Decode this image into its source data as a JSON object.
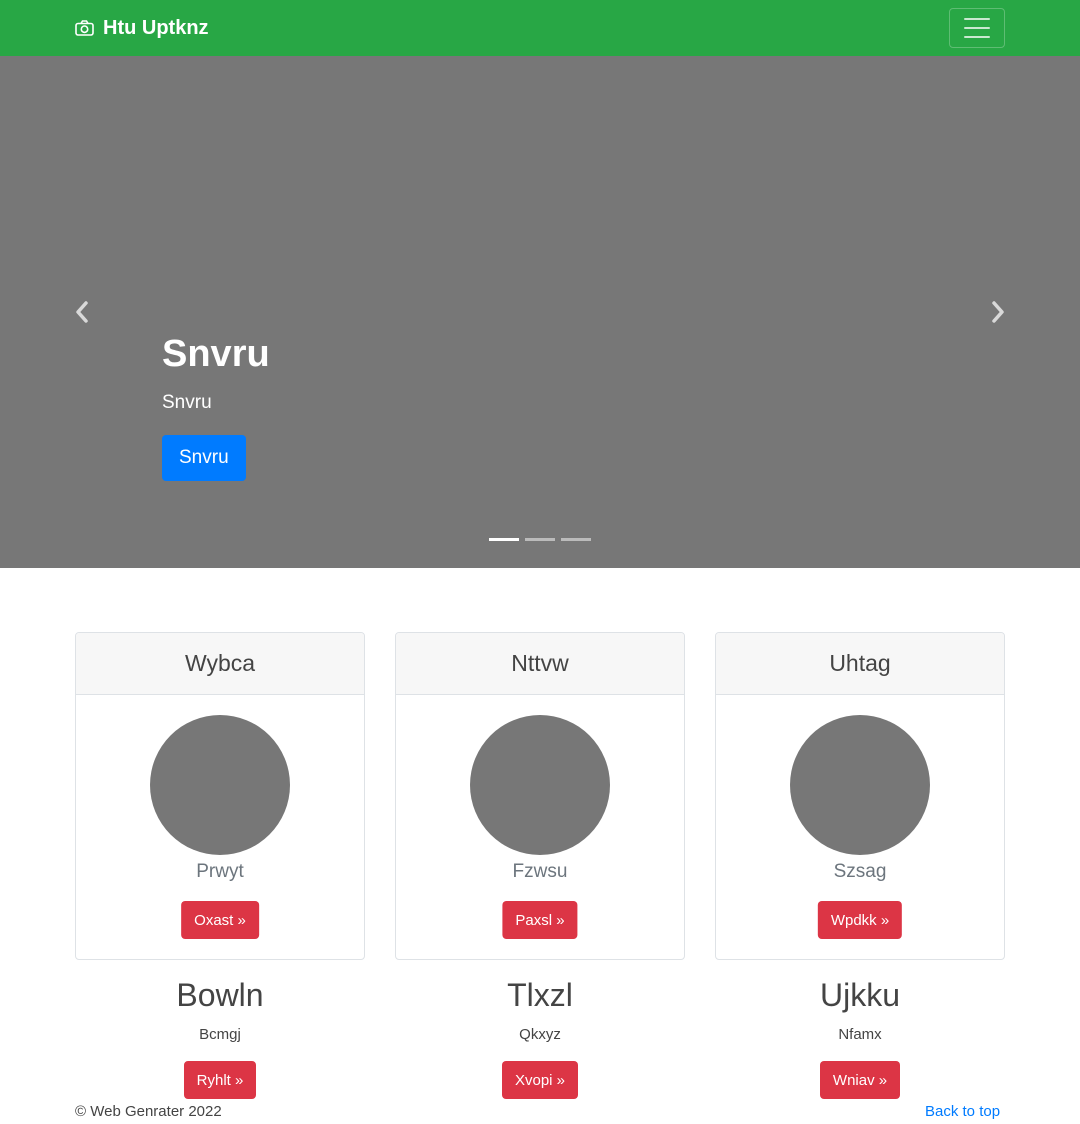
{
  "navbar": {
    "brand": "Htu Uptknz",
    "brand_icon": "camera-icon",
    "toggler_icon": "hamburger-icon",
    "background": "#28a745"
  },
  "carousel": {
    "background": "#777777",
    "title": "Snvru",
    "text": "Snvru",
    "button": "Snvru",
    "prev_icon": "chevron-left-icon",
    "next_icon": "chevron-right-icon",
    "indicators": 3,
    "active_indicator": 1
  },
  "cards": [
    {
      "header": "Wybca",
      "subtitle": "Prwyt",
      "button": "Oxast »"
    },
    {
      "header": "Nttvw",
      "subtitle": "Fzwsu",
      "button": "Paxsl »"
    },
    {
      "header": "Uhtag",
      "subtitle": "Szsag",
      "button": "Wpdkk »"
    }
  ],
  "columns": [
    {
      "heading": "Bowln",
      "text": "Bcmgj",
      "button": "Ryhlt »"
    },
    {
      "heading": "Tlxzl",
      "text": "Qkxyz",
      "button": "Xvopi »"
    },
    {
      "heading": "Ujkku",
      "text": "Nfamx",
      "button": "Wniav »"
    }
  ],
  "footer": {
    "copyright": "© Web Genrater 2022",
    "back_to_top": "Back to top"
  },
  "colors": {
    "primary": "#007bff",
    "danger": "#dc3545",
    "success": "#28a745"
  }
}
